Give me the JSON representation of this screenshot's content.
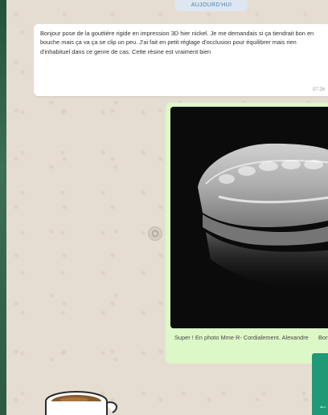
{
  "chat": {
    "date_label": "AUJOURD'HUI",
    "incoming_message": {
      "text": "Bonjour pose de la gouttière rigide en impression 3D hier nickel. Je me demandais si ça tiendrait bon en bouche mais ça va ça se clip un peu. J'ai fait en petit réglage d'occlusion pour équilibrer mais rien d'inhabituel dans ce genre de cas. Cette résine est vraiment bien",
      "time": "07:26"
    },
    "outgoing_message": {
      "caption": "Super ! En photo Mme R- Cordialement. Alexandre",
      "caption_overflow": "Bon"
    }
  },
  "colors": {
    "chat_background": "#e6ddd2",
    "incoming_bubble": "#ffffff",
    "outgoing_bubble": "#dcf8c6",
    "accent": "#1f9a77"
  },
  "icons": {
    "forward": "forward-icon",
    "scroll_down": "arrow-icon"
  }
}
